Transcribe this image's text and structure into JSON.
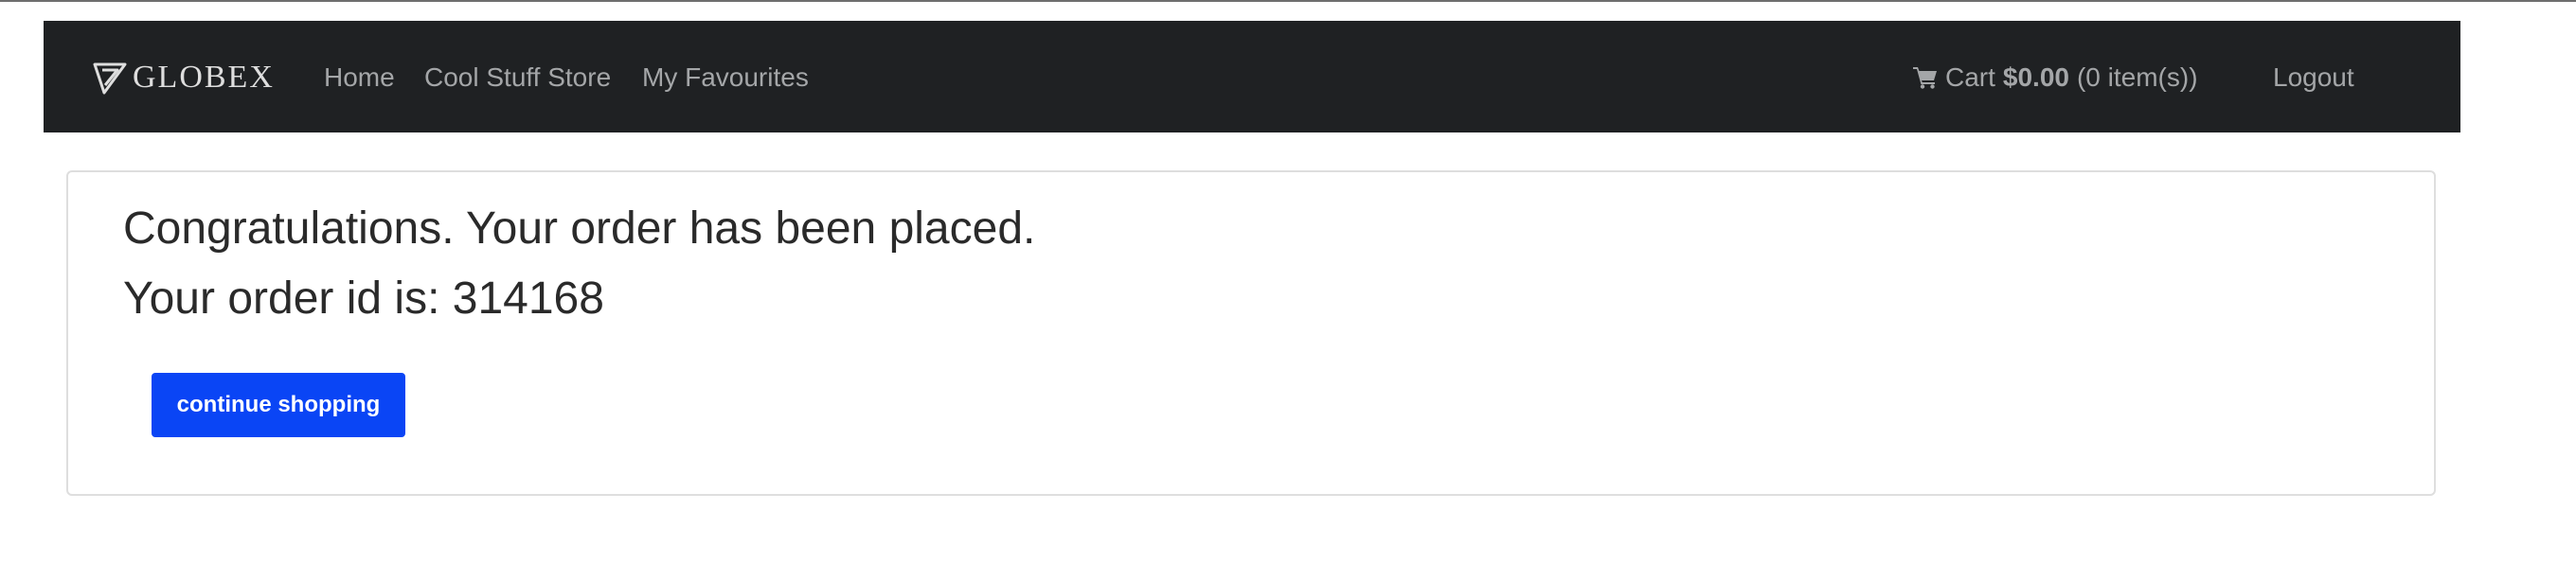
{
  "brand": {
    "name": "GLOBEX",
    "logo_icon": "globex-triangle-icon"
  },
  "nav": {
    "items": [
      {
        "label": "Home"
      },
      {
        "label": "Cool Stuff Store"
      },
      {
        "label": "My Favourites"
      }
    ],
    "cart": {
      "icon": "shopping-cart-icon",
      "label": "Cart",
      "amount": "$0.00",
      "items_text": "(0 item(s))"
    },
    "logout_label": "Logout"
  },
  "confirmation": {
    "message": "Congratulations. Your order has been placed.",
    "order_id_text": "Your order id is: 314168",
    "continue_label": "continue shopping"
  },
  "colors": {
    "navbar_bg": "#1f2123",
    "nav_text": "#a4a6a8",
    "button_bg": "#0a45f5",
    "button_text": "#ffffff",
    "panel_border": "#dedede"
  }
}
